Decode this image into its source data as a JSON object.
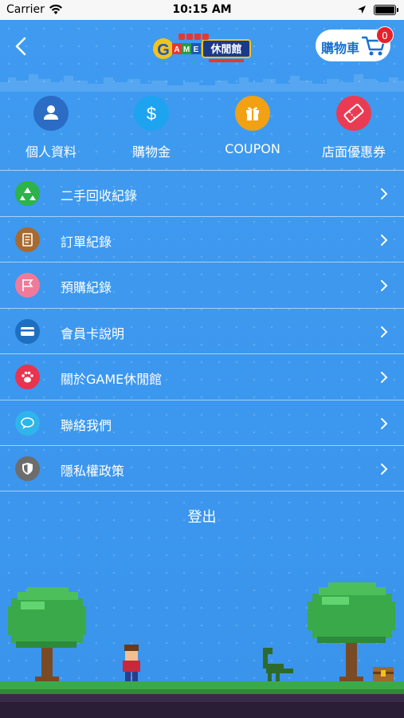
{
  "status_bar": {
    "carrier": "Carrier",
    "time": "10:15 AM"
  },
  "header": {
    "logo_text": "GAME休閒館",
    "cart_label": "購物車",
    "cart_count": "0"
  },
  "quick_actions": [
    {
      "label": "個人資料",
      "icon": "person-icon",
      "color": "#2b6cc4"
    },
    {
      "label": "購物金",
      "icon": "dollar-icon",
      "color": "#1ea3f0"
    },
    {
      "label": "COUPON",
      "icon": "gift-icon",
      "color": "#f2a114"
    },
    {
      "label": "店面優惠券",
      "icon": "ticket-icon",
      "color": "#ea3b53"
    }
  ],
  "menu": [
    {
      "label": "二手回收紀錄",
      "icon": "recycle-icon",
      "color": "#2eb24a"
    },
    {
      "label": "訂單紀錄",
      "icon": "document-icon",
      "color": "#a86a30"
    },
    {
      "label": "預購紀錄",
      "icon": "flag-icon",
      "color": "#f07a9a"
    },
    {
      "label": "會員卡說明",
      "icon": "credit-card-icon",
      "color": "#1e6fc0"
    },
    {
      "label": "關於GAME休閒館",
      "icon": "paw-icon",
      "color": "#e8344e"
    },
    {
      "label": "聯絡我們",
      "icon": "chat-icon",
      "color": "#2fb4ec"
    },
    {
      "label": "隱私權政策",
      "icon": "shield-icon",
      "color": "#6d6d6d"
    }
  ],
  "logout_label": "登出"
}
